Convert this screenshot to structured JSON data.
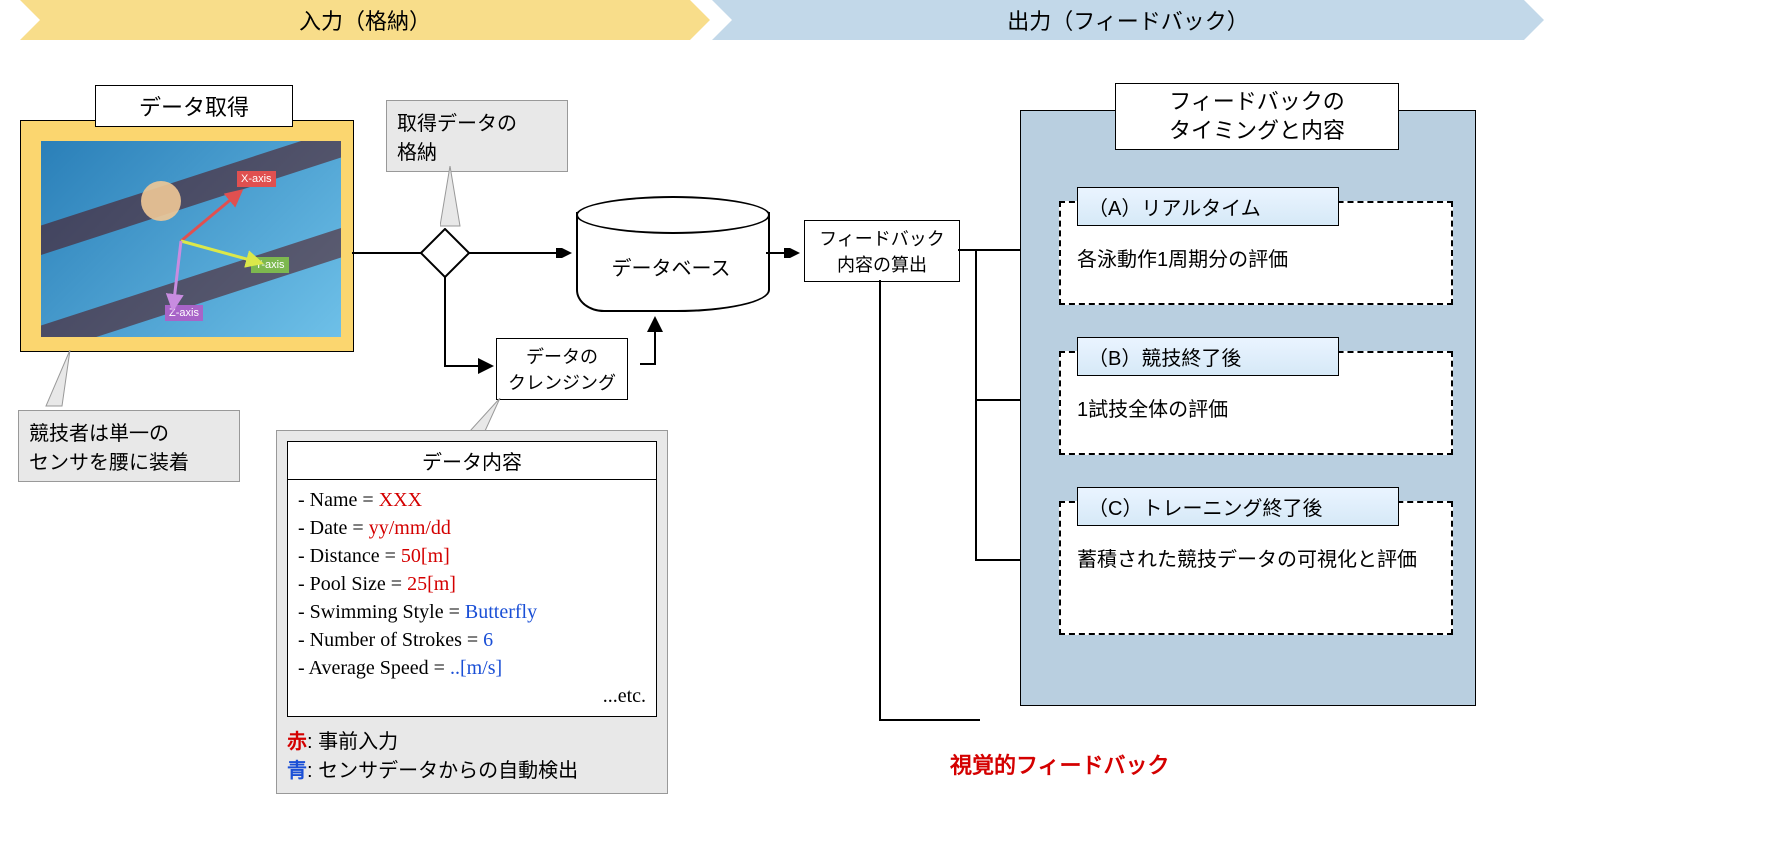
{
  "header": {
    "input_label": "入力（格納）",
    "output_label": "出力（フィードバック）"
  },
  "acquisition": {
    "title": "データ取得",
    "axis_x": "X-axis",
    "axis_y": "Y-axis",
    "axis_z": "Z-axis",
    "sensor_note_line1": "競技者は単一の",
    "sensor_note_line2": "センサを腰に装着"
  },
  "storage_note": {
    "line1": "取得データの",
    "line2": "格納"
  },
  "database_label": "データベース",
  "cleansing": {
    "line1": "データの",
    "line2": "クレンジング"
  },
  "feedback_calc": {
    "line1": "フィードバック",
    "line2": "内容の算出"
  },
  "data_content": {
    "title": "データ内容",
    "items": [
      {
        "label": "- Name = ",
        "value": "XXX",
        "cls": "red"
      },
      {
        "label": "- Date = ",
        "value": "yy/mm/dd",
        "cls": "red"
      },
      {
        "label": "- Distance = ",
        "value": "50[m]",
        "cls": "red"
      },
      {
        "label": "- Pool Size = ",
        "value": "25[m]",
        "cls": "red"
      },
      {
        "label": "- Swimming Style = ",
        "value": "Butterfly",
        "cls": "blue"
      },
      {
        "label": "- Number of Strokes = ",
        "value": "6",
        "cls": "blue"
      },
      {
        "label": "- Average Speed = ",
        "value": "..[m/s]",
        "cls": "blue"
      }
    ],
    "etc": "...etc.",
    "legend_red_key": "赤",
    "legend_red_val": ": 事前入力",
    "legend_blue_key": "青",
    "legend_blue_val": ": センサデータからの自動検出"
  },
  "feedback_panel": {
    "title_line1": "フィードバックの",
    "title_line2": "タイミングと内容",
    "boxes": [
      {
        "tab": "（A）リアルタイム",
        "body": "各泳動作1周期分の評価"
      },
      {
        "tab": "（B）競技終了後",
        "body": "1試技全体の評価"
      },
      {
        "tab": "（C）トレーニング終了後",
        "body": "蓄積された競技データの可視化と評価"
      }
    ]
  },
  "visual_feedback_label": "視覚的フィードバック"
}
